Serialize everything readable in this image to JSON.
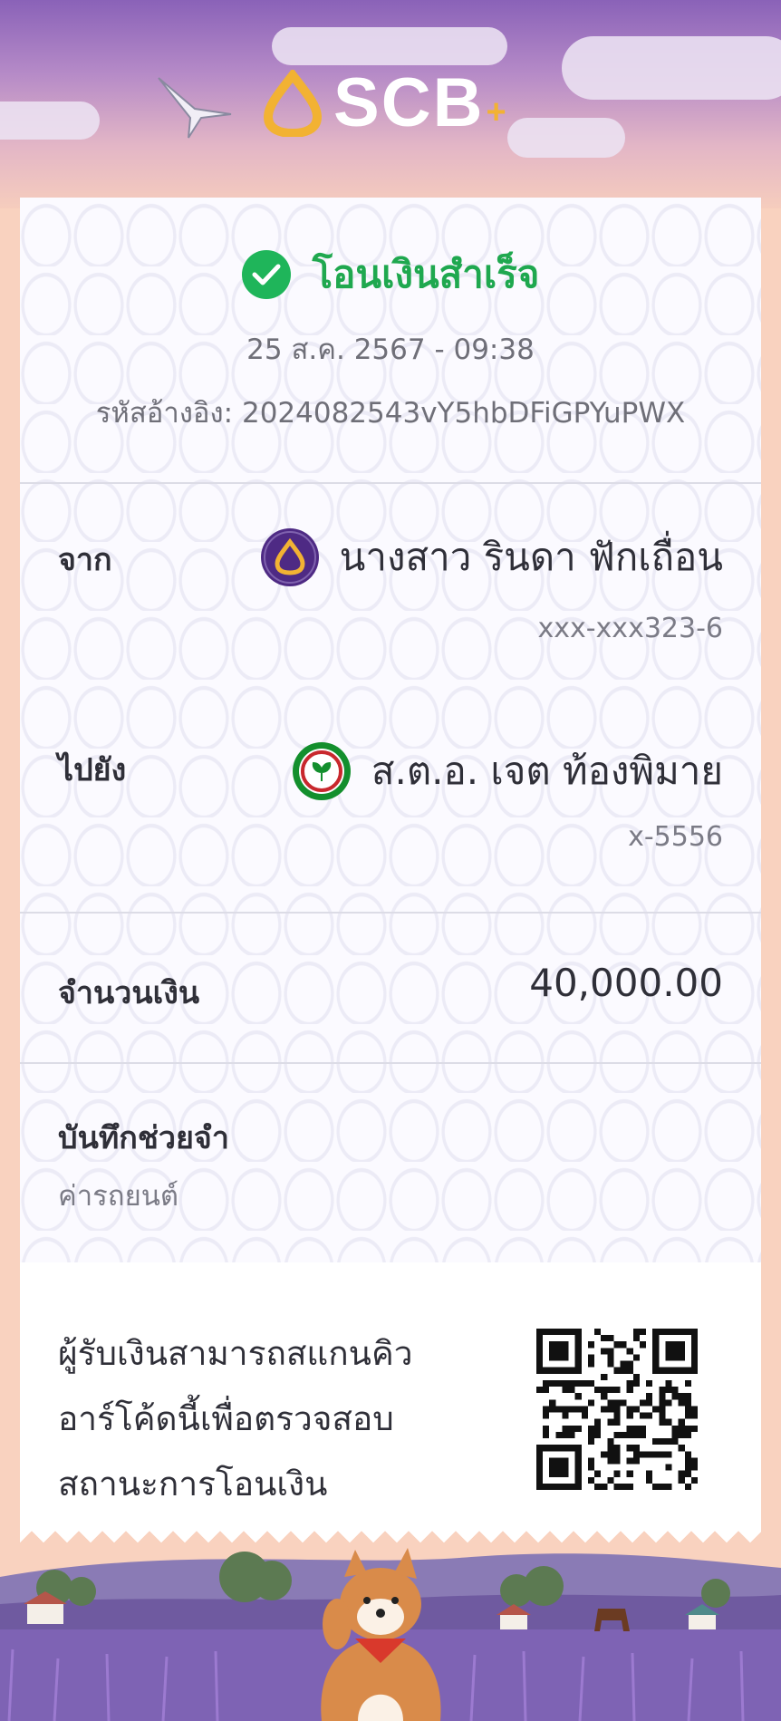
{
  "brand": {
    "name": "SCB",
    "plus": "+"
  },
  "transfer": {
    "status": "โอนเงินสำเร็จ",
    "datetime": "25 ส.ค. 2567 - 09:38",
    "reference": "รหัสอ้างอิง: 2024082543vY5hbDFiGPYuPWX"
  },
  "from": {
    "label": "จาก",
    "name": "นางสาว รินดา ฟักเถื่อน",
    "account": "xxx-xxx323-6"
  },
  "to": {
    "label": "ไปยัง",
    "name": "ส.ต.อ. เจต ท้องพิมาย",
    "account": "x-5556"
  },
  "amount": {
    "label": "จำนวนเงิน",
    "value": "40,000.00"
  },
  "memo": {
    "label": "บันทึกช่วยจำ",
    "value": "ค่ารถยนต์"
  },
  "qr": {
    "line1": "ผู้รับเงินสามารถสแกนคิว",
    "line2": "อาร์โค้ดนี้เพื่อตรวจสอบ",
    "line3": "สถานะการโอนเงิน"
  },
  "colors": {
    "success": "#1fa84f",
    "scb_purple": "#4e2a84",
    "scb_gold": "#f2b233",
    "kbank_green": "#138f2d"
  },
  "icons": [
    "check-circle-icon",
    "scb-logo-icon",
    "kbank-logo-icon",
    "qr-code"
  ]
}
